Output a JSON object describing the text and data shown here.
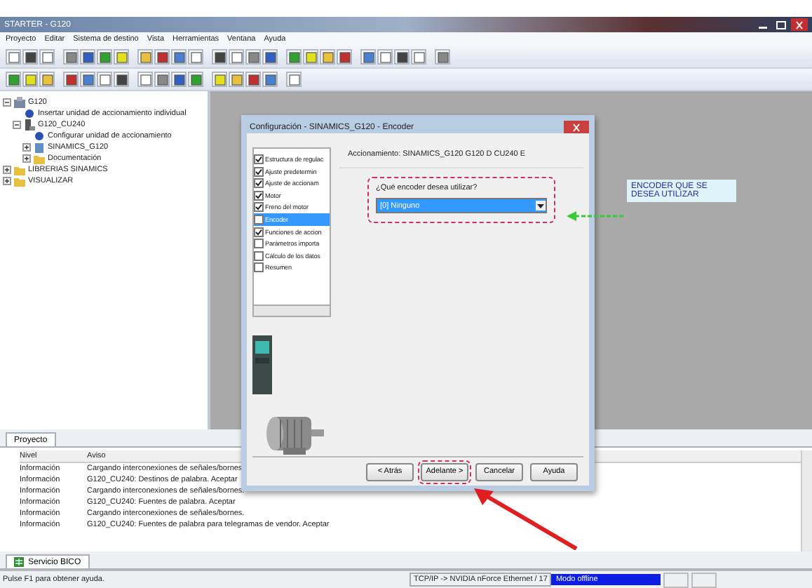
{
  "window": {
    "title": "STARTER - G120"
  },
  "menu": [
    "Proyecto",
    "Editar",
    "Sistema de destino",
    "Vista",
    "Herramientas",
    "Ventana",
    "Ayuda"
  ],
  "tree": [
    {
      "label": "G120",
      "kind": "project",
      "expanded": true,
      "children": [
        {
          "label": "Insertar unidad de accionamiento individual",
          "kind": "action"
        },
        {
          "label": "G120_CU240",
          "kind": "drive",
          "expanded": true,
          "children": [
            {
              "label": "Configurar unidad de accionamiento",
              "kind": "action"
            },
            {
              "label": "SINAMICS_G120",
              "kind": "device",
              "expanded": false
            },
            {
              "label": "Documentación",
              "kind": "folder",
              "expanded": false
            }
          ]
        }
      ]
    },
    {
      "label": "LIBRERIAS SINAMICS",
      "kind": "folder",
      "expanded": false
    },
    {
      "label": "VISUALIZAR",
      "kind": "folder",
      "expanded": false
    }
  ],
  "project_tab": {
    "label": "Proyecto",
    "selected": true
  },
  "dialog": {
    "title": "Configuración - SINAMICS_G120 - Encoder",
    "steps": [
      {
        "label": "Estructura de regulac",
        "checked": true,
        "selected": false
      },
      {
        "label": "Ajuste predetermin",
        "checked": true,
        "selected": false
      },
      {
        "label": "Ajuste de accionam",
        "checked": true,
        "selected": false
      },
      {
        "label": "Motor",
        "checked": true,
        "selected": false
      },
      {
        "label": "Freno del motor",
        "checked": true,
        "selected": false
      },
      {
        "label": "Encoder",
        "checked": false,
        "selected": true
      },
      {
        "label": "Funciones de accion",
        "checked": true,
        "selected": false
      },
      {
        "label": "Parámetros importa",
        "checked": false,
        "selected": false
      },
      {
        "label": "Cálculo de los datos",
        "checked": false,
        "selected": false
      },
      {
        "label": "Resumen",
        "checked": false,
        "selected": false
      }
    ],
    "drive_label": "Accionamiento: SINAMICS_G120 G120 D CU240 E",
    "question": "¿Qué encoder desea utilizar?",
    "encoder_value": "[0] Ninguno",
    "buttons": [
      "< Atrás",
      "Adelante >",
      "Cancelar",
      "Ayuda"
    ]
  },
  "annotation": "ENCODER QUE SE DESEA UTILIZAR",
  "output": {
    "columns": [
      "Nivel",
      "Aviso"
    ],
    "rows": [
      [
        "Información",
        "Cargando interconexiones de señales/bornes"
      ],
      [
        "Información",
        "G120_CU240: Destinos de palabra. Aceptar"
      ],
      [
        "Información",
        "Cargando interconexiones de señales/bornes."
      ],
      [
        "Información",
        "G120_CU240: Fuentes de palabra. Aceptar"
      ],
      [
        "Información",
        "Cargando interconexiones de señales/bornes."
      ],
      [
        "Información",
        "G120_CU240: Fuentes de palabra para telegramas de vendor. Aceptar"
      ]
    ]
  },
  "output_tab": {
    "label": "Servicio BICO",
    "selected": true
  },
  "status_bar": {
    "help": "Pulse F1 para obtener ayuda.",
    "interface": "TCP/IP -> NVIDIA nForce Ethernet / 17",
    "mode": "Modo offline"
  }
}
